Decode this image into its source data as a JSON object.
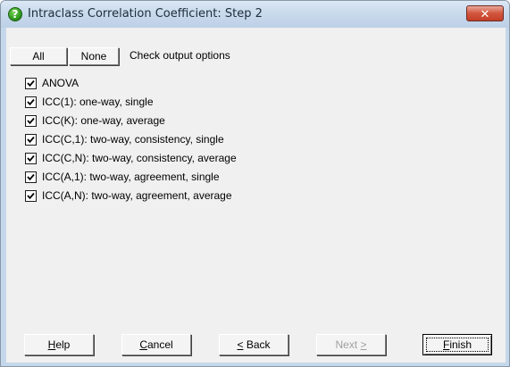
{
  "window": {
    "title": "Intraclass Correlation Coefficient: Step 2",
    "help_glyph": "?",
    "close_glyph": "✕"
  },
  "top_buttons": {
    "all": "All",
    "none": "None",
    "label": "Check output options"
  },
  "options": [
    {
      "label": "ANOVA",
      "checked": true
    },
    {
      "label": "ICC(1): one-way, single",
      "checked": true
    },
    {
      "label": "ICC(K): one-way, average",
      "checked": true
    },
    {
      "label": "ICC(C,1): two-way, consistency, single",
      "checked": true
    },
    {
      "label": "ICC(C,N): two-way, consistency, average",
      "checked": true
    },
    {
      "label": "ICC(A,1): two-way, agreement, single",
      "checked": true
    },
    {
      "label": "ICC(A,N): two-way, agreement, average",
      "checked": true
    }
  ],
  "buttons": {
    "help": {
      "accel": "H",
      "rest": "elp"
    },
    "cancel": {
      "accel": "C",
      "rest": "ancel"
    },
    "back": {
      "accel": "<",
      "rest": " Back"
    },
    "next": {
      "pre": "Next ",
      "accel": ">"
    },
    "finish": {
      "accel": "F",
      "rest": "inish"
    }
  },
  "colors": {
    "titlebar": "#c9daec",
    "client": "#f0f0f0",
    "close": "#c94a31"
  }
}
